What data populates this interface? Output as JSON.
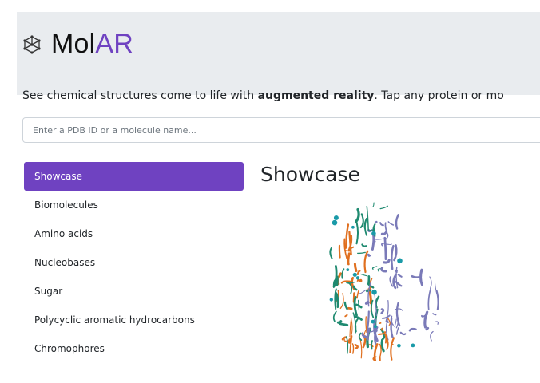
{
  "header": {
    "logo_icon": "cube-network-icon",
    "title_part1": "Mol",
    "title_part2": "AR",
    "accent_color": "#6f42c1",
    "background": "#e9ecef"
  },
  "tagline": {
    "prefix": "See chemical structures come to life with ",
    "emphasis": "augmented reality",
    "suffix": ". Tap any protein or mo"
  },
  "search": {
    "placeholder": "Enter a PDB ID or a molecule name...",
    "value": ""
  },
  "sidebar": {
    "items": [
      {
        "label": "Showcase",
        "active": true
      },
      {
        "label": "Biomolecules",
        "active": false
      },
      {
        "label": "Amino acids",
        "active": false
      },
      {
        "label": "Nucleobases",
        "active": false
      },
      {
        "label": "Sugar",
        "active": false
      },
      {
        "label": "Polycyclic aromatic hydrocarbons",
        "active": false
      },
      {
        "label": "Chromophores",
        "active": false
      }
    ]
  },
  "main": {
    "title": "Showcase",
    "image": {
      "icon": "protein-structure-ribbon-icon",
      "colors": [
        "#e07020",
        "#1f8a70",
        "#7a7ab8",
        "#1a9aa8"
      ]
    }
  }
}
